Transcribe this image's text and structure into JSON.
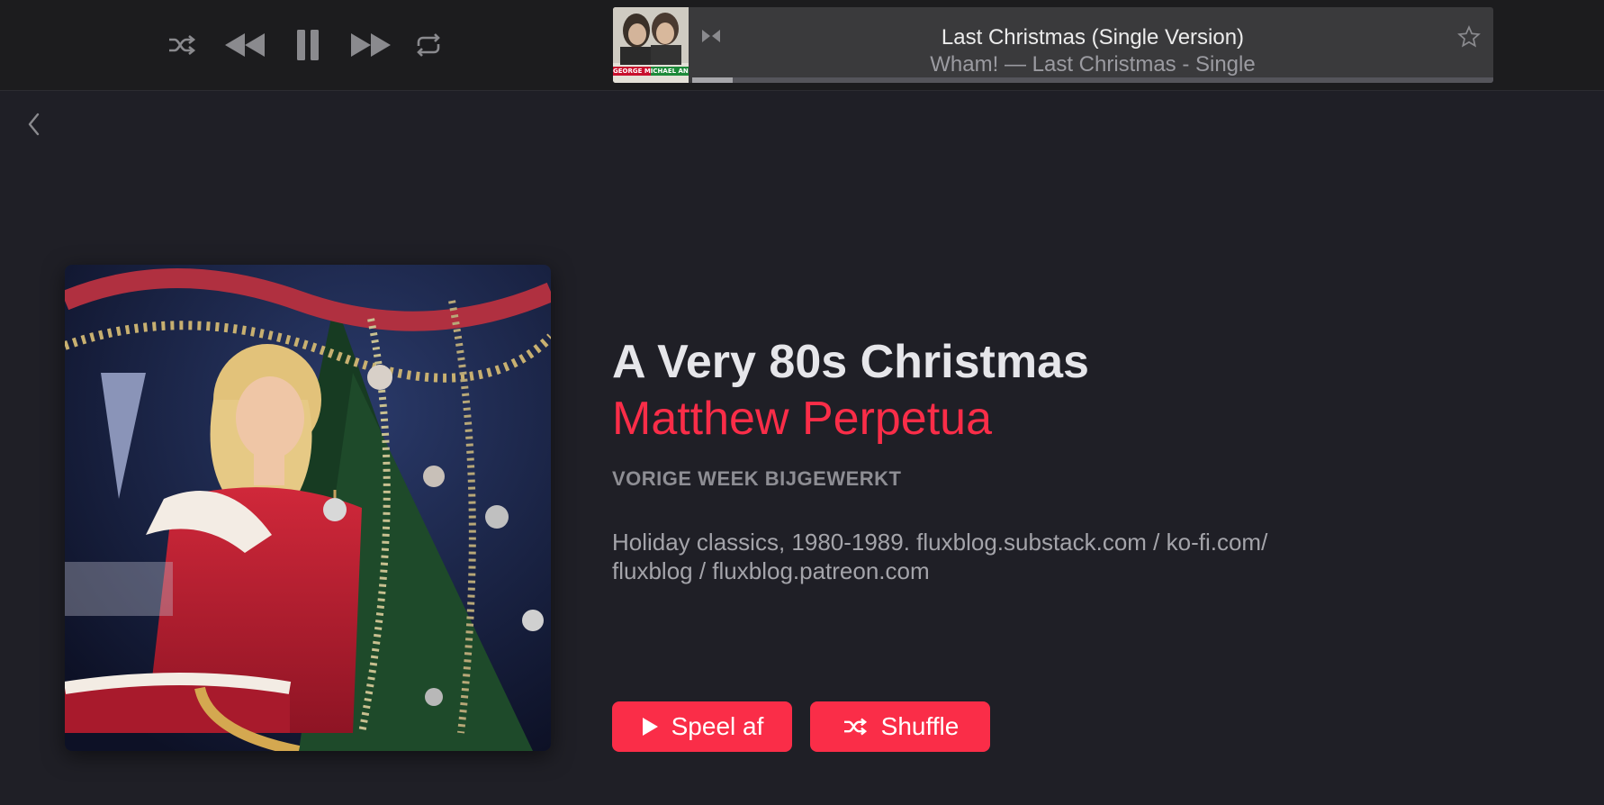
{
  "now_playing": {
    "title": "Last Christmas (Single Version)",
    "subtitle": "Wham! — Last Christmas - Single",
    "progress": 0.05,
    "art_text": "GEORGE MICHAEL   ANDREW RIDGELEY"
  },
  "playlist": {
    "title": "A Very 80s Christmas",
    "curator": "Matthew Perpetua",
    "updated": "VORIGE WEEK BIJGEWERKT",
    "description": "Holiday classics, 1980-1989. fluxblog.substack.com / ko-fi.com/ fluxblog / fluxblog.patreon.com"
  },
  "actions": {
    "play_label": "Speel af",
    "shuffle_label": "Shuffle"
  },
  "colors": {
    "accent": "#fa2d48",
    "background": "#1f1f26",
    "toolbar": "#1c1c1e"
  },
  "icons": {
    "transport": [
      "shuffle-icon",
      "previous-icon",
      "pause-icon",
      "next-icon",
      "repeat-icon"
    ],
    "lcd": [
      "airplay-icon",
      "star-icon"
    ],
    "nav": [
      "chevron-left-icon"
    ]
  }
}
